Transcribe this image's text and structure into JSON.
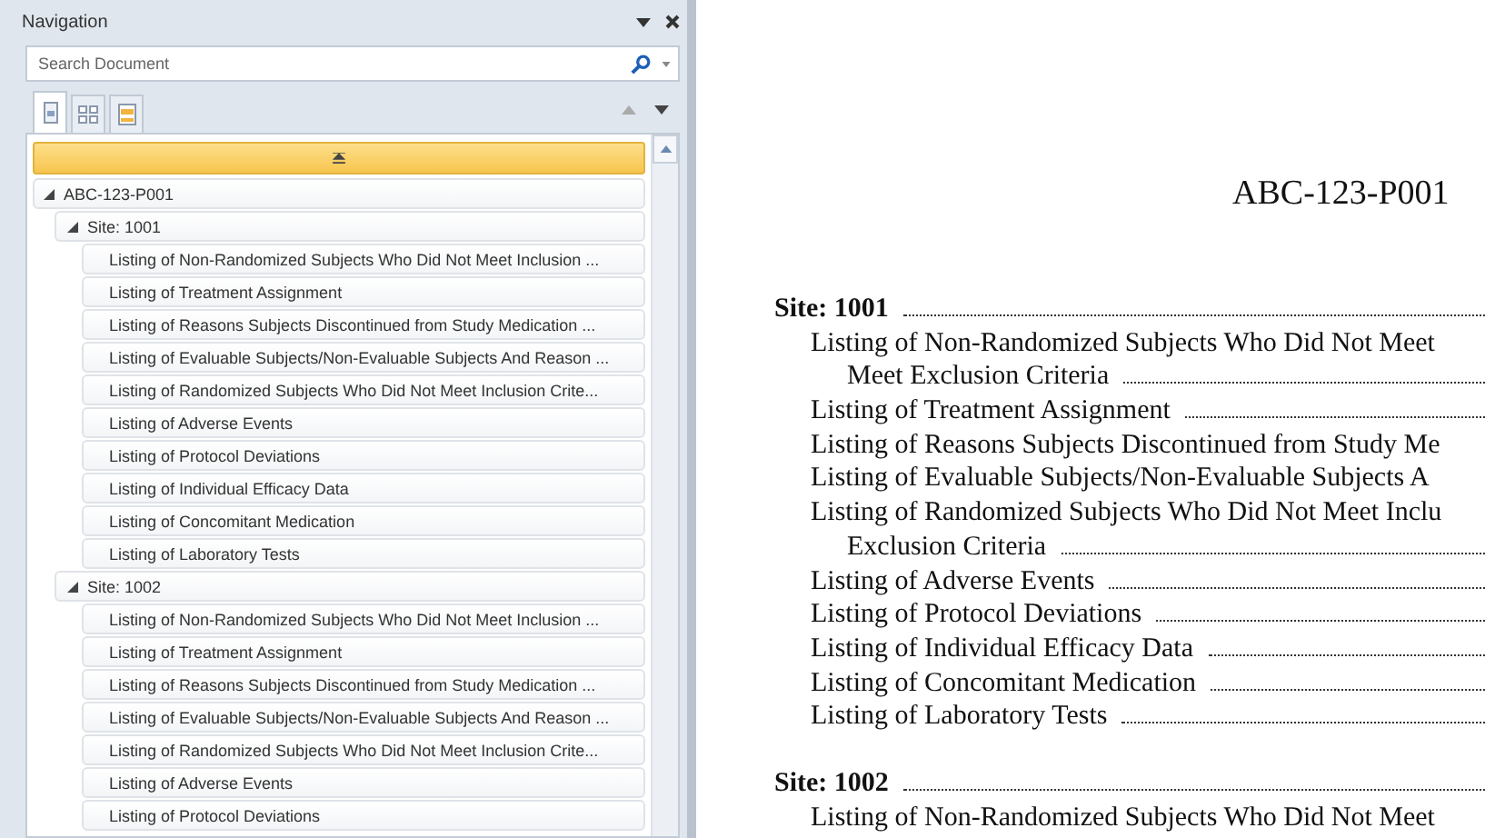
{
  "navigation": {
    "title": "Navigation",
    "search": {
      "placeholder": "Search Document"
    },
    "tabs": [
      {
        "kind": "headings",
        "selected": true
      },
      {
        "kind": "pages",
        "selected": false
      },
      {
        "kind": "results",
        "selected": false
      }
    ],
    "tree": [
      {
        "label": "ABC-123-P001",
        "expanded": true,
        "children": [
          {
            "label": "Site: 1001",
            "expanded": true,
            "children": [
              {
                "label": "Listing of Non-Randomized Subjects Who Did Not Meet Inclusion ..."
              },
              {
                "label": "Listing of Treatment Assignment"
              },
              {
                "label": "Listing of Reasons Subjects Discontinued from Study Medication ..."
              },
              {
                "label": "Listing of Evaluable Subjects/Non-Evaluable Subjects And Reason ..."
              },
              {
                "label": "Listing of Randomized Subjects Who Did Not Meet Inclusion Crite..."
              },
              {
                "label": "Listing of Adverse Events"
              },
              {
                "label": "Listing of Protocol Deviations"
              },
              {
                "label": "Listing of Individual Efficacy Data"
              },
              {
                "label": "Listing of Concomitant Medication"
              },
              {
                "label": "Listing of Laboratory Tests"
              }
            ]
          },
          {
            "label": "Site: 1002",
            "expanded": true,
            "children": [
              {
                "label": "Listing of Non-Randomized Subjects Who Did Not Meet Inclusion ..."
              },
              {
                "label": "Listing of Treatment Assignment"
              },
              {
                "label": "Listing of Reasons Subjects Discontinued from Study Medication ..."
              },
              {
                "label": "Listing of Evaluable Subjects/Non-Evaluable Subjects And Reason ..."
              },
              {
                "label": "Listing of Randomized Subjects Who Did Not Meet Inclusion Crite..."
              },
              {
                "label": "Listing of Adverse Events"
              },
              {
                "label": "Listing of Protocol Deviations"
              }
            ]
          }
        ]
      }
    ]
  },
  "document": {
    "title": "ABC-123-P001",
    "sections": [
      {
        "heading": "Site: 1001",
        "entries": [
          {
            "lines": [
              {
                "text": "Listing of Non-Randomized Subjects Who Did Not Meet",
                "leader": false
              },
              {
                "text": "Meet Exclusion Criteria",
                "leader": true
              }
            ]
          },
          {
            "lines": [
              {
                "text": "Listing of Treatment Assignment",
                "leader": true
              }
            ]
          },
          {
            "lines": [
              {
                "text": "Listing of Reasons Subjects Discontinued from Study Me",
                "leader": false
              }
            ]
          },
          {
            "lines": [
              {
                "text": "Listing of Evaluable Subjects/Non-Evaluable Subjects A",
                "leader": false
              }
            ]
          },
          {
            "lines": [
              {
                "text": "Listing of Randomized Subjects Who Did Not Meet Inclu",
                "leader": false
              },
              {
                "text": "Exclusion Criteria",
                "leader": true
              }
            ]
          },
          {
            "lines": [
              {
                "text": "Listing of Adverse Events",
                "leader": true
              }
            ]
          },
          {
            "lines": [
              {
                "text": "Listing of Protocol Deviations",
                "leader": true
              }
            ]
          },
          {
            "lines": [
              {
                "text": "Listing of Individual Efficacy Data",
                "leader": true
              }
            ]
          },
          {
            "lines": [
              {
                "text": "Listing of Concomitant Medication",
                "leader": true
              }
            ]
          },
          {
            "lines": [
              {
                "text": "Listing of Laboratory Tests",
                "leader": true
              }
            ]
          }
        ]
      },
      {
        "heading": "Site: 1002",
        "entries": [
          {
            "lines": [
              {
                "text": "Listing of Non-Randomized Subjects Who Did Not Meet",
                "leader": false
              }
            ]
          }
        ]
      }
    ]
  }
}
